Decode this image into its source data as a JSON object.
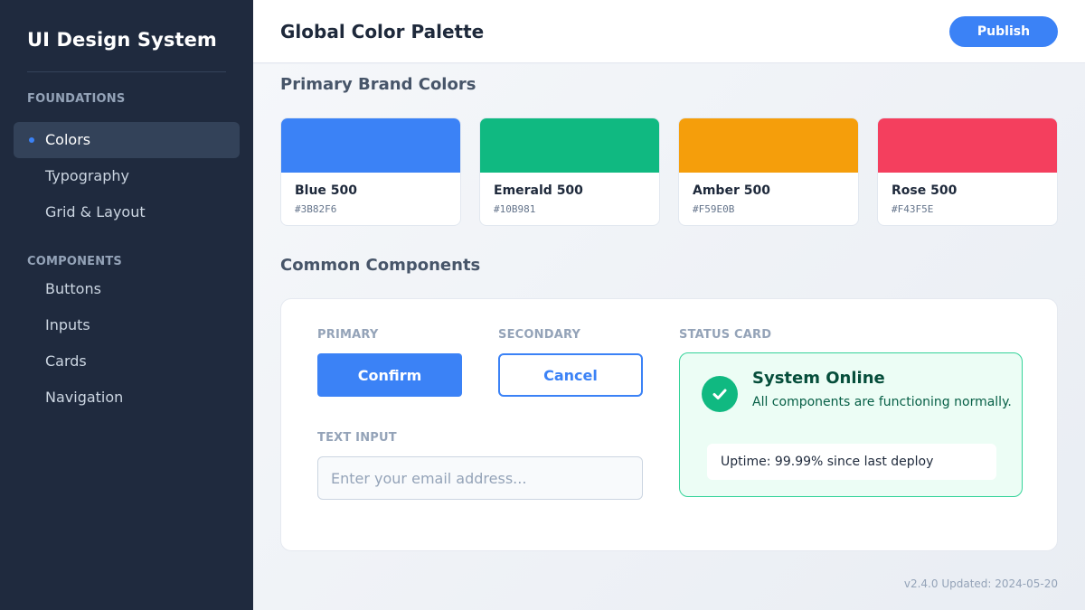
{
  "sidebar": {
    "brand": "UI Design System",
    "sections": [
      {
        "label": "FOUNDATIONS",
        "items": [
          {
            "label": "Colors",
            "active": true
          },
          {
            "label": "Typography",
            "active": false
          },
          {
            "label": "Grid & Layout",
            "active": false
          }
        ]
      },
      {
        "label": "COMPONENTS",
        "items": [
          {
            "label": "Buttons",
            "active": false
          },
          {
            "label": "Inputs",
            "active": false
          },
          {
            "label": "Cards",
            "active": false
          },
          {
            "label": "Navigation",
            "active": false
          }
        ]
      }
    ]
  },
  "header": {
    "title": "Global Color Palette",
    "publish_label": "Publish"
  },
  "main": {
    "brand_colors_heading": "Primary Brand Colors",
    "swatches": [
      {
        "name": "Blue 500",
        "hex": "#3B82F6",
        "color": "#3b82f6"
      },
      {
        "name": "Emerald 500",
        "hex": "#10B981",
        "color": "#10b981"
      },
      {
        "name": "Amber 500",
        "hex": "#F59E0B",
        "color": "#f59e0b"
      },
      {
        "name": "Rose 500",
        "hex": "#F43F5E",
        "color": "#f43f5e"
      }
    ],
    "components_heading": "Common Components",
    "components": {
      "primary_caption": "PRIMARY",
      "primary_button": "Confirm",
      "secondary_caption": "SECONDARY",
      "secondary_button": "Cancel",
      "text_input_caption": "TEXT INPUT",
      "text_input_value": "",
      "text_input_placeholder": "Enter your email address...",
      "status_caption": "STATUS CARD",
      "status_title": "System Online",
      "status_description": "All components are functioning normally.",
      "status_uptime": "Uptime: 99.99% since last deploy",
      "status_icon": "check-circle-icon"
    },
    "version_text": "v2.4.0 Updated: 2024-05-20"
  }
}
